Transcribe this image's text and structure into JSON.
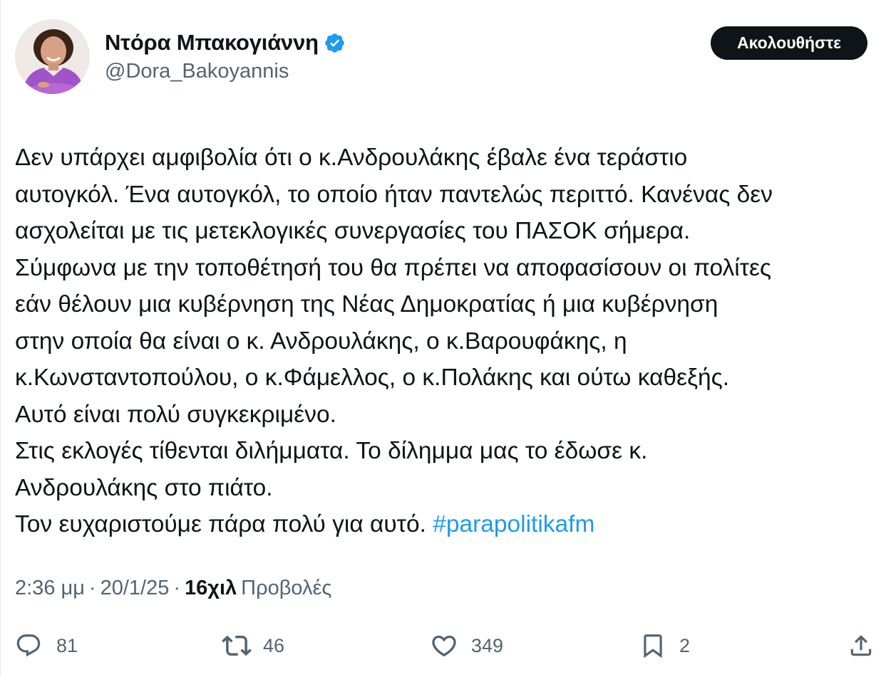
{
  "author": {
    "display_name": "Ντόρα Μπακογιάννη",
    "handle": "@Dora_Bakoyannis",
    "verified": true,
    "verified_color": "#1d9bf0"
  },
  "follow_button": {
    "label": "Ακολουθήστε"
  },
  "tweet": {
    "lines": [
      "Δεν υπάρχει αμφιβολία ότι ο κ.Ανδρουλάκης έβαλε ένα τεράστιο",
      "αυτογκόλ. Ένα αυτογκόλ, το οποίο ήταν παντελώς περιττό. Κανένας δεν",
      "ασχολείται με τις μετεκλογικές συνεργασίες του ΠΑΣΟΚ σήμερα.",
      "Σύμφωνα με την τοποθέτησή του θα πρέπει να αποφασίσουν οι πολίτες",
      "εάν θέλουν μια κυβέρνηση της Νέας Δημοκρατίας ή μια κυβέρνηση",
      "στην οποία θα είναι ο κ. Ανδρουλάκης, ο κ.Βαρουφάκης, η",
      "κ.Κωνσταντοπούλου, ο κ.Φάμελλος, ο κ.Πολάκης και ούτω καθεξής.",
      "Αυτό είναι πολύ συγκεκριμένο.",
      "Στις εκλογές τίθενται διλήμματα. Το δίλημμα μας το έδωσε κ.",
      "Ανδρουλάκης στο πιάτο."
    ],
    "last_line_text": "Τον ευχαριστούμε πάρα πολύ για αυτό. ",
    "hashtag": "#parapolitikafm",
    "hashtag_color": "#1d9bf0"
  },
  "meta": {
    "time": "2:36 μμ",
    "separator": "·",
    "date": "20/1/25",
    "views_count": "16χιλ",
    "views_label": "Προβολές"
  },
  "actions": {
    "replies": {
      "icon": "reply-icon",
      "count": "81"
    },
    "reposts": {
      "icon": "repost-icon",
      "count": "46"
    },
    "likes": {
      "icon": "heart-icon",
      "count": "349"
    },
    "bookmarks": {
      "icon": "bookmark-icon",
      "count": "2"
    },
    "share": {
      "icon": "share-icon"
    }
  }
}
